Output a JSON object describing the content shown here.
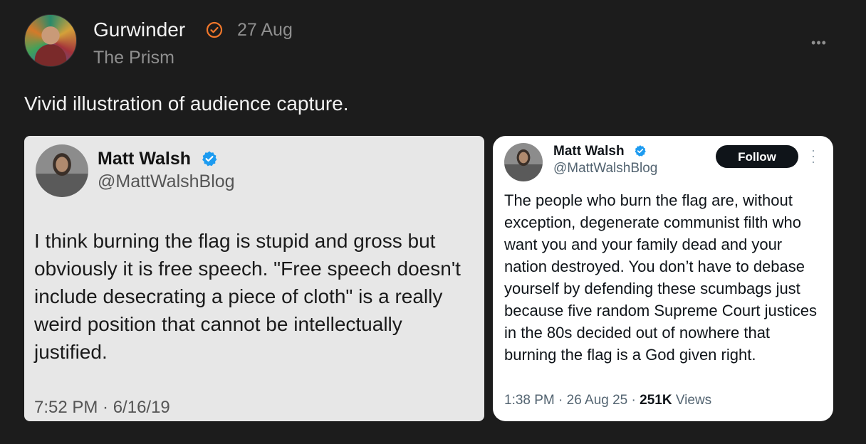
{
  "post": {
    "author": "Gurwinder",
    "date": "27 Aug",
    "publication": "The Prism",
    "text": "Vivid illustration of audience capture.",
    "more_icon": "ellipsis-icon",
    "verified_color": "#f0772b"
  },
  "left_tweet": {
    "name": "Matt Walsh",
    "handle": "@MattWalshBlog",
    "text": "I think burning the flag is stupid and gross but obviously it is free speech. \"Free speech doesn't include desecrating a piece of cloth\" is a really weird position that cannot be intellectually justified.",
    "timestamp": "7:52 PM · 6/16/19"
  },
  "right_tweet": {
    "name": "Matt Walsh",
    "handle": "@MattWalshBlog",
    "follow_label": "Follow",
    "text": "The people who burn the flag are, without exception, degenerate communist filth who want you and your family dead and your nation destroyed. You don’t have to debase yourself by defending these scumbags just because five random Supreme Court justices in the 80s decided out of nowhere that burning the flag is a God given right.",
    "time": "1:38 PM",
    "date": "26 Aug 25",
    "views_count": "251K",
    "views_label": "Views"
  },
  "colors": {
    "verified_blue": "#1d9bf0",
    "background": "#1c1c1c"
  }
}
